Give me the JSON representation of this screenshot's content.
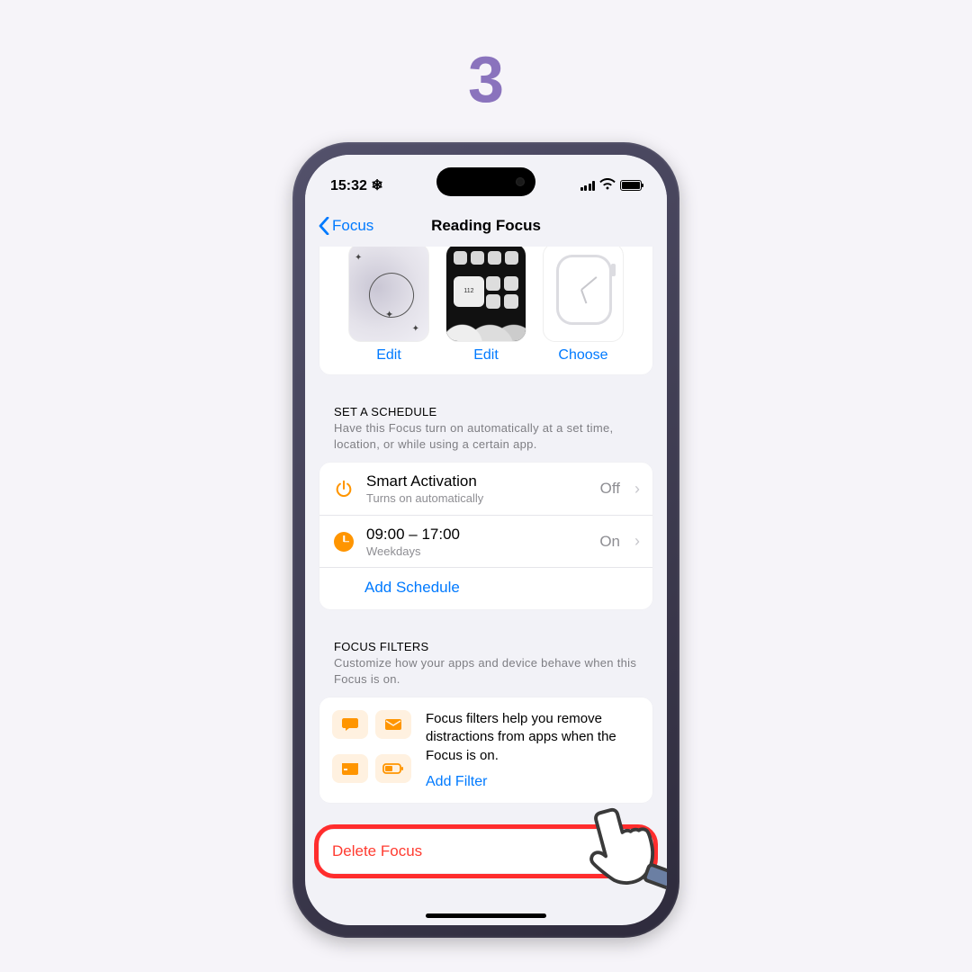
{
  "step_number": "3",
  "statusbar": {
    "time": "15:32 ❄"
  },
  "navbar": {
    "back_label": "Focus",
    "title": "Reading Focus"
  },
  "screens": {
    "lock_label": "Edit",
    "home_label": "Edit",
    "watch_label": "Choose",
    "widget_text": "112"
  },
  "schedule": {
    "header": "SET A SCHEDULE",
    "desc": "Have this Focus turn on automatically at a set time, location, or while using a certain app.",
    "smart": {
      "title": "Smart Activation",
      "sub": "Turns on automatically",
      "value": "Off"
    },
    "time": {
      "title": "09:00 – 17:00",
      "sub": "Weekdays",
      "value": "On"
    },
    "add_label": "Add Schedule"
  },
  "filters": {
    "header": "FOCUS FILTERS",
    "desc": "Customize how your apps and device behave when this Focus is on.",
    "body": "Focus filters help you remove distractions from apps when the Focus is on.",
    "add_label": "Add Filter"
  },
  "delete_label": "Delete Focus"
}
